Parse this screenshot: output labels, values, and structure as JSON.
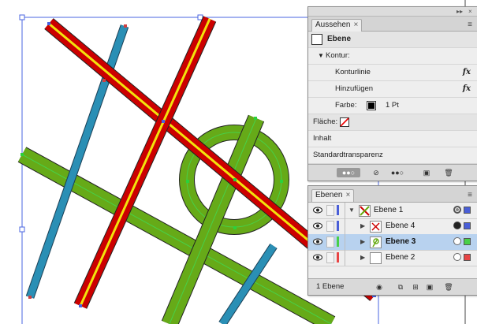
{
  "colors": {
    "panel_bg": "#eeeeee",
    "selected_row": "#b8d2ef",
    "road_red": "#cc0000",
    "road_yellow": "#f2e30c",
    "path_blue": "#2a8fb5",
    "path_green": "#66aa18",
    "layer1_color": "#4a5fd8",
    "layer4_color": "#4a5fd8",
    "layer3_color": "#48d048",
    "layer2_color": "#e84545"
  },
  "appearance_panel": {
    "tab_label": "Aussehen",
    "close_glyph": "×",
    "object_type": "Ebene",
    "stroke_section": "Kontur:",
    "stroke_line": "Konturlinie",
    "add_label": "Hinzufügen",
    "color_label": "Farbe:",
    "stroke_weight": "1 Pt",
    "fill_label": "Fläche:",
    "contents_label": "Inhalt",
    "transparency_label": "Standardtransparenz",
    "fx_glyph": "fx"
  },
  "layers_panel": {
    "tab_label": "Ebenen",
    "close_glyph": "×",
    "layers": [
      {
        "name": "Ebene 1",
        "color": "#4a5fd8"
      },
      {
        "name": "Ebene 4",
        "color": "#4a5fd8"
      },
      {
        "name": "Ebene 3",
        "color": "#48d048"
      },
      {
        "name": "Ebene 2",
        "color": "#e84545"
      }
    ],
    "count_label": "1 Ebene"
  }
}
